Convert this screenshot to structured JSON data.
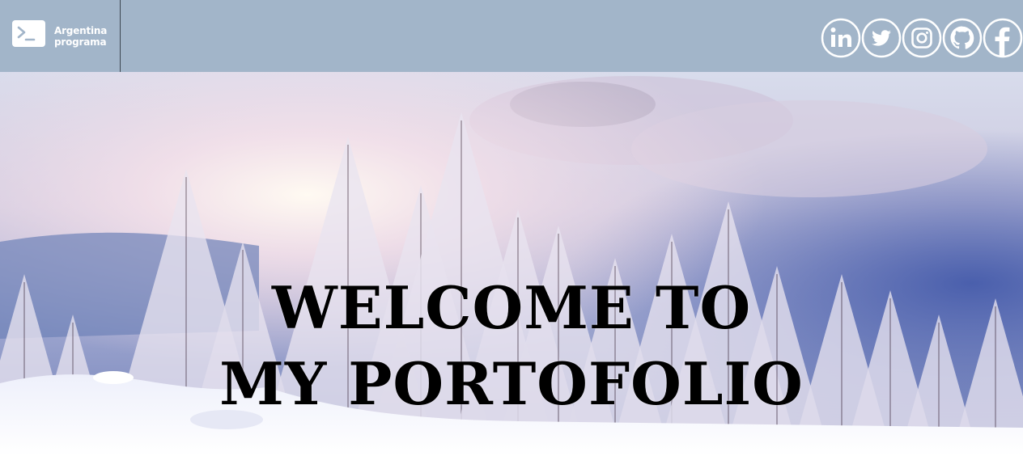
{
  "header": {
    "brand": {
      "line1": "Argentina",
      "line2": "programa",
      "icon": "terminal-prompt-icon"
    },
    "social_links": [
      {
        "name": "linkedin",
        "icon": "linkedin-icon"
      },
      {
        "name": "twitter",
        "icon": "twitter-icon"
      },
      {
        "name": "instagram",
        "icon": "instagram-icon"
      },
      {
        "name": "github",
        "icon": "github-icon"
      },
      {
        "name": "facebook",
        "icon": "facebook-icon"
      }
    ],
    "background_color": "#a2b5c9"
  },
  "hero": {
    "title_line1": "WELCOME TO",
    "title_line2": "MY PORTOFOLIO",
    "background": "snowy-winter-forest-image"
  }
}
